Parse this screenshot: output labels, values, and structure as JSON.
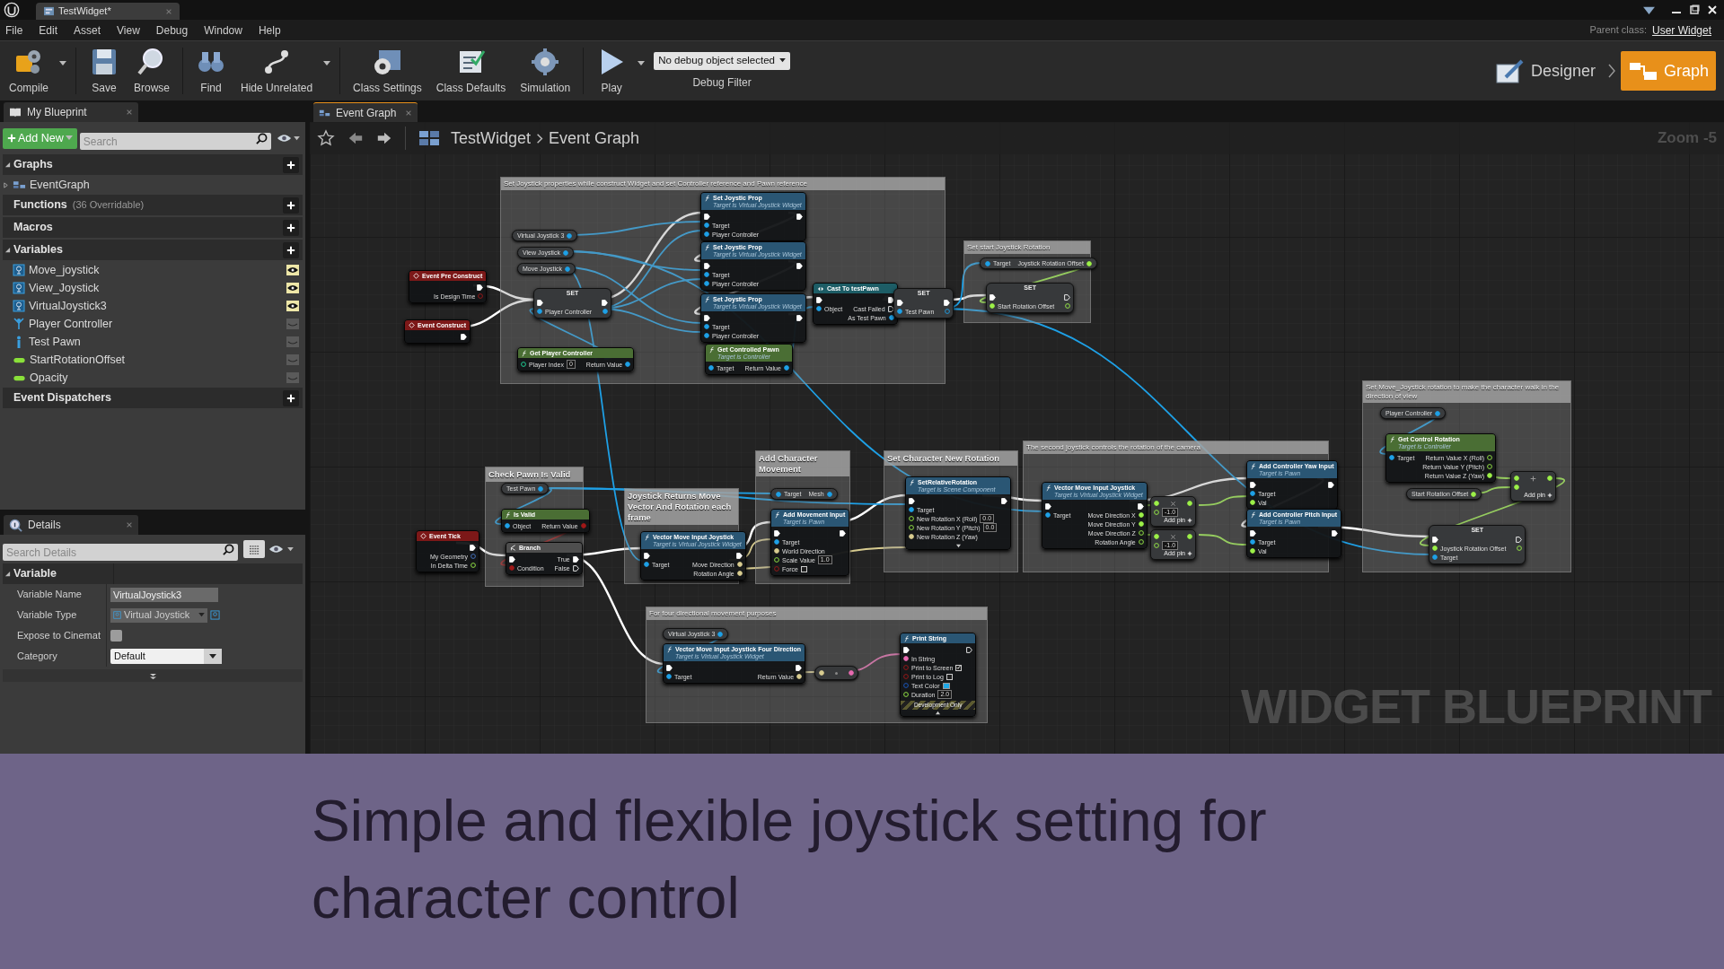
{
  "title_bar": {
    "tabs": [
      {
        "label": "TestWidget*",
        "selected": true
      }
    ]
  },
  "menu": [
    "File",
    "Edit",
    "Asset",
    "View",
    "Debug",
    "Window",
    "Help"
  ],
  "parent_class": {
    "label": "Parent class:",
    "value": "User Widget"
  },
  "toolbar": {
    "buttons": [
      {
        "label": "Compile",
        "kind": "compile",
        "dropdown": true
      },
      {
        "label": "Save",
        "kind": "save",
        "dropdown": false
      },
      {
        "label": "Browse",
        "kind": "browse",
        "dropdown": false
      },
      {
        "label": "Find",
        "kind": "find",
        "dropdown": false
      },
      {
        "label": "Hide Unrelated",
        "kind": "hide",
        "dropdown": true
      },
      {
        "label": "Class Settings",
        "kind": "settings",
        "dropdown": false
      },
      {
        "label": "Class Defaults",
        "kind": "defaults",
        "dropdown": false
      },
      {
        "label": "Simulation",
        "kind": "simulation",
        "dropdown": false
      },
      {
        "label": "Play",
        "kind": "play",
        "dropdown": true
      }
    ],
    "debug_filter": {
      "value": "No debug object selected",
      "label": "Debug Filter"
    },
    "modes": [
      {
        "label": "Designer",
        "kind": "designer",
        "selected": false
      },
      {
        "label": "Graph",
        "kind": "graph",
        "selected": true
      }
    ]
  },
  "my_blueprint": {
    "tab": "My Blueprint",
    "add_new": "Add New",
    "search": {
      "placeholder": "Search"
    },
    "sections": [
      {
        "title": "Graphs",
        "expanded": true,
        "items": [
          {
            "label": "EventGraph",
            "kind": "graph",
            "expanded": false
          }
        ]
      },
      {
        "title": "Functions",
        "note": "(36 Overridable)",
        "expanded": false
      },
      {
        "title": "Macros",
        "expanded": false
      },
      {
        "title": "Variables",
        "expanded": true,
        "items": [
          {
            "label": "Move_joystick",
            "kind": "widget",
            "exposed": true
          },
          {
            "label": "View_Joystick",
            "kind": "widget",
            "exposed": true
          },
          {
            "label": "VirtualJoystick3",
            "kind": "widget",
            "exposed": true
          },
          {
            "label": "Player Controller",
            "kind": "controller",
            "exposed": false
          },
          {
            "label": "Test Pawn",
            "kind": "pawn",
            "exposed": false
          },
          {
            "label": "StartRotationOffset",
            "kind": "float",
            "exposed": false
          },
          {
            "label": "Opacity",
            "kind": "float",
            "exposed": false
          }
        ]
      },
      {
        "title": "Event Dispatchers",
        "expanded": false
      }
    ]
  },
  "details": {
    "tab": "Details",
    "search": {
      "placeholder": "Search Details"
    },
    "category": "Variable",
    "properties": [
      {
        "label": "Variable Name",
        "kind": "text",
        "value": "VirtualJoystick3"
      },
      {
        "label": "Variable Type",
        "kind": "type",
        "value": "Virtual Joystick"
      },
      {
        "label": "Expose to Cinemat",
        "kind": "checkbox",
        "checked": false
      },
      {
        "label": "Category",
        "kind": "dropdown",
        "value": "Default"
      }
    ]
  },
  "graph": {
    "tab": "Event Graph",
    "breadcrumb": [
      "TestWidget",
      "Event Graph"
    ],
    "zoom": "Zoom -5",
    "graph_type_label": "WIDGET BLUEPRINT",
    "comments": [
      {
        "title": "Set Joystick properties while construct Widget and set Controller reference and Pawn reference"
      },
      {
        "title": "Set start Joystick Rotation"
      },
      {
        "title": "Set Move_Joystick rotation to make the character walk in the direction of view"
      },
      {
        "title": "Check Pawn Is Valid"
      },
      {
        "title": "Joystick Returns Move Vector And Rotation each frame"
      },
      {
        "title": "Add Character Movement"
      },
      {
        "title": "Set Character New Rotation"
      },
      {
        "title": "The second joystick controls the rotation of the camera"
      },
      {
        "title": "For four directional movement purposes"
      }
    ],
    "nodes": [
      {
        "kind": "event",
        "title": "Event Pre Construct",
        "outputs": [
          {
            "kind": "exec",
            "linked": true
          },
          {
            "kind": "bool",
            "label": "Is Design Time",
            "linked": false
          }
        ]
      },
      {
        "kind": "event",
        "title": "Event Construct",
        "outputs": [
          {
            "kind": "exec",
            "linked": true
          }
        ]
      },
      {
        "kind": "event",
        "title": "Event Tick",
        "outputs": [
          {
            "kind": "exec",
            "linked": true
          },
          {
            "kind": "struct",
            "label": "My Geometry",
            "linked": false
          },
          {
            "kind": "float",
            "label": "In Delta Time",
            "linked": false
          }
        ]
      },
      {
        "kind": "getter",
        "outputs": [
          {
            "kind": "object",
            "label": "Virtual Joystick 3",
            "linked": true
          }
        ]
      },
      {
        "kind": "getter",
        "outputs": [
          {
            "kind": "object",
            "label": "View Joystick",
            "linked": true
          }
        ]
      },
      {
        "kind": "getter",
        "outputs": [
          {
            "kind": "object",
            "label": "Move Joystick",
            "linked": true
          }
        ]
      },
      {
        "kind": "set",
        "title": "SET",
        "inputs": [
          {
            "kind": "exec",
            "linked": true
          },
          {
            "kind": "object",
            "label": "Player Controller",
            "linked": true
          }
        ],
        "outputs": [
          {
            "kind": "exec",
            "linked": true
          },
          {
            "kind": "object",
            "linked": true
          }
        ]
      },
      {
        "kind": "pure",
        "title": "Get Player Controller",
        "inputs": [
          {
            "kind": "int",
            "label": "Player Index",
            "value": "0",
            "linked": false
          }
        ],
        "outputs": [
          {
            "kind": "object",
            "label": "Return Value",
            "linked": true
          }
        ]
      },
      {
        "kind": "function",
        "title": "Set Joystic Prop",
        "subtitle": "Target is Virtual Joystick Widget",
        "inputs": [
          {
            "kind": "exec",
            "linked": true
          },
          {
            "kind": "object",
            "label": "Target",
            "linked": true
          },
          {
            "kind": "object",
            "label": "Player Controller",
            "linked": true
          }
        ],
        "outputs": [
          {
            "kind": "exec",
            "linked": true
          }
        ]
      },
      {
        "kind": "function",
        "title": "Set Joystic Prop",
        "subtitle": "Target is Virtual Joystick Widget",
        "inputs": [
          {
            "kind": "exec",
            "linked": true
          },
          {
            "kind": "object",
            "label": "Target",
            "linked": true
          },
          {
            "kind": "object",
            "label": "Player Controller",
            "linked": true
          }
        ],
        "outputs": [
          {
            "kind": "exec",
            "linked": true
          }
        ]
      },
      {
        "kind": "function",
        "title": "Set Joystic Prop",
        "subtitle": "Target is Virtual Joystick Widget",
        "inputs": [
          {
            "kind": "exec",
            "linked": true
          },
          {
            "kind": "object",
            "label": "Target",
            "linked": true
          },
          {
            "kind": "object",
            "label": "Player Controller",
            "linked": true
          }
        ],
        "outputs": [
          {
            "kind": "exec",
            "linked": true
          }
        ]
      },
      {
        "kind": "pure",
        "title": "Get Controlled Pawn",
        "subtitle": "Target is Controller",
        "inputs": [
          {
            "kind": "object",
            "label": "Target",
            "linked": true
          }
        ],
        "outputs": [
          {
            "kind": "object",
            "label": "Return Value",
            "linked": true
          }
        ]
      },
      {
        "kind": "cast",
        "title": "Cast To testPawn",
        "inputs": [
          {
            "kind": "exec",
            "linked": true
          },
          {
            "kind": "object",
            "label": "Object",
            "linked": true
          }
        ],
        "outputs": [
          {
            "kind": "exec",
            "linked": true
          },
          {
            "kind": "exec",
            "label": "Cast Failed",
            "linked": false
          },
          {
            "kind": "object",
            "label": "As Test Pawn",
            "linked": true
          }
        ]
      },
      {
        "kind": "set",
        "title": "SET",
        "inputs": [
          {
            "kind": "exec",
            "linked": true
          },
          {
            "kind": "object",
            "label": "Test Pawn",
            "linked": true
          }
        ],
        "outputs": [
          {
            "kind": "exec",
            "linked": true
          },
          {
            "kind": "object",
            "linked": false
          }
        ]
      },
      {
        "kind": "getter",
        "inputs": [
          {
            "kind": "object",
            "label": "Target",
            "linked": true
          }
        ],
        "outputs": [
          {
            "kind": "float",
            "label": "Joystick Rotation Offset",
            "linked": true
          }
        ]
      },
      {
        "kind": "set",
        "title": "SET",
        "inputs": [
          {
            "kind": "exec",
            "linked": true
          },
          {
            "kind": "float",
            "label": "Start Rotation Offset",
            "linked": true
          }
        ],
        "outputs": [
          {
            "kind": "exec",
            "linked": false
          },
          {
            "kind": "float",
            "linked": false
          }
        ]
      },
      {
        "kind": "getter",
        "outputs": [
          {
            "kind": "object",
            "label": "Test Pawn",
            "linked": true
          }
        ]
      },
      {
        "kind": "pure",
        "title": "Is Valid",
        "inputs": [
          {
            "kind": "object",
            "label": "Object",
            "linked": true
          }
        ],
        "outputs": [
          {
            "kind": "bool",
            "label": "Return Value",
            "linked": true
          }
        ]
      },
      {
        "kind": "macro",
        "title": "Branch",
        "inputs": [
          {
            "kind": "exec",
            "linked": true
          },
          {
            "kind": "bool",
            "label": "Condition",
            "linked": true
          }
        ],
        "outputs": [
          {
            "kind": "exec",
            "label": "True",
            "linked": true
          },
          {
            "kind": "exec",
            "label": "False",
            "linked": false
          }
        ]
      },
      {
        "kind": "function",
        "title": "Vector Move Input Joystick",
        "subtitle": "Target is Virtual Joystick Widget",
        "inputs": [
          {
            "kind": "exec",
            "linked": true
          },
          {
            "kind": "object",
            "label": "Target",
            "linked": true
          }
        ],
        "outputs": [
          {
            "kind": "exec",
            "linked": true
          },
          {
            "kind": "vector",
            "label": "Move Direction",
            "linked": true
          },
          {
            "kind": "vector",
            "label": "Rotation Angle",
            "linked": true
          }
        ]
      },
      {
        "kind": "getter",
        "inputs": [
          {
            "kind": "object",
            "label": "Target",
            "linked": true
          }
        ],
        "outputs": [
          {
            "kind": "object",
            "label": "Mesh",
            "linked": true
          }
        ]
      },
      {
        "kind": "function",
        "title": "Add Movement Input",
        "subtitle": "Target is Pawn",
        "inputs": [
          {
            "kind": "exec",
            "linked": true
          },
          {
            "kind": "object",
            "label": "Target",
            "linked": true
          },
          {
            "kind": "vector",
            "label": "World Direction",
            "linked": true
          },
          {
            "kind": "float",
            "label": "Scale Value",
            "value": "1.0",
            "linked": false
          },
          {
            "kind": "bool",
            "label": "Force",
            "checked": false,
            "linked": false
          }
        ],
        "outputs": [
          {
            "kind": "exec",
            "linked": true
          }
        ]
      },
      {
        "kind": "function",
        "title": "SetRelativeRotation",
        "subtitle": "Target is Scene Component",
        "advanced_expanded": false,
        "inputs": [
          {
            "kind": "exec",
            "linked": true
          },
          {
            "kind": "object",
            "label": "Target",
            "linked": true
          },
          {
            "kind": "float",
            "label": "New Rotation X (Roll)",
            "value": "0.0",
            "linked": false
          },
          {
            "kind": "float",
            "label": "New Rotation Y (Pitch)",
            "value": "0.0",
            "linked": false
          },
          {
            "kind": "vector",
            "label": "New Rotation Z (Yaw)",
            "linked": true
          }
        ],
        "outputs": [
          {
            "kind": "exec",
            "linked": true
          }
        ]
      },
      {
        "kind": "function",
        "title": "Vector Move Input Joystick",
        "subtitle": "Target is Virtual Joystick Widget",
        "inputs": [
          {
            "kind": "exec",
            "linked": true
          },
          {
            "kind": "object",
            "label": "Target",
            "linked": true
          }
        ],
        "outputs": [
          {
            "kind": "exec",
            "linked": true
          },
          {
            "kind": "float",
            "label": "Move Direction X",
            "linked": true
          },
          {
            "kind": "float",
            "label": "Move Direction Y",
            "linked": true
          },
          {
            "kind": "float",
            "label": "Move Direction Z",
            "linked": false
          },
          {
            "kind": "float",
            "label": "Rotation Angle",
            "linked": false
          }
        ]
      },
      {
        "kind": "multiply",
        "footer": "Add pin",
        "inputs": [
          {
            "kind": "float",
            "linked": true
          },
          {
            "kind": "float",
            "value": "-1.0",
            "linked": false
          }
        ],
        "outputs": [
          {
            "kind": "float",
            "linked": true
          }
        ]
      },
      {
        "kind": "multiply",
        "footer": "Add pin",
        "inputs": [
          {
            "kind": "float",
            "linked": true
          },
          {
            "kind": "float",
            "value": "-1.0",
            "linked": false
          }
        ],
        "outputs": [
          {
            "kind": "float",
            "linked": true
          }
        ]
      },
      {
        "kind": "function",
        "title": "Add Controller Yaw Input",
        "subtitle": "Target is Pawn",
        "inputs": [
          {
            "kind": "exec",
            "linked": true
          },
          {
            "kind": "object",
            "label": "Target",
            "linked": true
          },
          {
            "kind": "float",
            "label": "Val",
            "linked": true
          }
        ],
        "outputs": [
          {
            "kind": "exec",
            "linked": true
          }
        ]
      },
      {
        "kind": "function",
        "title": "Add Controller Pitch Input",
        "subtitle": "Target is Pawn",
        "inputs": [
          {
            "kind": "exec",
            "linked": true
          },
          {
            "kind": "object",
            "label": "Target",
            "linked": true
          },
          {
            "kind": "float",
            "label": "Val",
            "linked": true
          }
        ],
        "outputs": [
          {
            "kind": "exec",
            "linked": true
          }
        ]
      },
      {
        "kind": "getter",
        "outputs": [
          {
            "kind": "object",
            "label": "Player Controller",
            "linked": true
          }
        ]
      },
      {
        "kind": "pure",
        "title": "Get Control Rotation",
        "subtitle": "Target is Controller",
        "inputs": [
          {
            "kind": "object",
            "label": "Target",
            "linked": true
          }
        ],
        "outputs": [
          {
            "kind": "float",
            "label": "Return Value X (Roll)",
            "linked": false
          },
          {
            "kind": "float",
            "label": "Return Value Y (Pitch)",
            "linked": false
          },
          {
            "kind": "float",
            "label": "Return Value Z (Yaw)",
            "linked": true
          }
        ]
      },
      {
        "kind": "getter",
        "outputs": [
          {
            "kind": "float",
            "label": "Start Rotation Offset",
            "linked": true
          }
        ]
      },
      {
        "kind": "add",
        "footer": "Add pin",
        "inputs": [
          {
            "kind": "float",
            "linked": true
          },
          {
            "kind": "float",
            "linked": true
          }
        ],
        "outputs": [
          {
            "kind": "float",
            "linked": true
          }
        ]
      },
      {
        "kind": "set",
        "title": "SET",
        "inputs": [
          {
            "kind": "exec",
            "linked": true
          },
          {
            "kind": "float",
            "label": "Joystick Rotation Offset",
            "linked": true
          },
          {
            "kind": "object",
            "label": "Target",
            "linked": true
          }
        ],
        "outputs": [
          {
            "kind": "exec",
            "linked": false
          },
          {
            "kind": "float",
            "linked": false
          }
        ]
      },
      {
        "kind": "getter",
        "outputs": [
          {
            "kind": "object",
            "label": "Virtual Joystick 3",
            "linked": true
          }
        ]
      },
      {
        "kind": "function",
        "title": "Vector Move Input Joystick Four Direction",
        "subtitle": "Target is Virtual Joystick Widget",
        "inputs": [
          {
            "kind": "exec",
            "linked": true
          },
          {
            "kind": "object",
            "label": "Target",
            "linked": true
          }
        ],
        "outputs": [
          {
            "kind": "exec",
            "linked": true
          },
          {
            "kind": "byte",
            "label": "Return Value",
            "linked": true
          }
        ]
      },
      {
        "kind": "convert",
        "inputs": [
          {
            "kind": "byte",
            "linked": true
          }
        ],
        "outputs": [
          {
            "kind": "string",
            "linked": true
          }
        ]
      },
      {
        "kind": "function",
        "title": "Print String",
        "footer": "Development Only",
        "advanced_expanded": true,
        "inputs": [
          {
            "kind": "exec",
            "linked": true
          },
          {
            "kind": "string",
            "label": "In String",
            "linked": true
          },
          {
            "kind": "bool",
            "label": "Print to Screen",
            "checked": true,
            "linked": false
          },
          {
            "kind": "bool",
            "label": "Print to Log",
            "checked": false,
            "linked": false
          },
          {
            "kind": "color",
            "label": "Text Color",
            "color": "#1ea8e8",
            "linked": false
          },
          {
            "kind": "float",
            "label": "Duration",
            "value": "2.0",
            "linked": false
          }
        ],
        "outputs": [
          {
            "kind": "exec",
            "linked": false
          }
        ]
      }
    ]
  },
  "caption": "Simple and flexible joystick setting for character control"
}
